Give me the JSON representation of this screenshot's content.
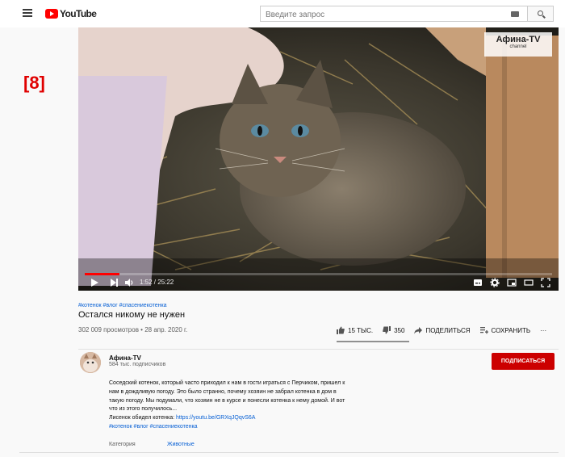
{
  "header": {
    "logo_text": "YouTube",
    "search_placeholder": "Введите запрос"
  },
  "page_tag": "[8]",
  "player": {
    "watermark_name": "Афина-TV",
    "watermark_sub": "channel",
    "time": "1:52 / 25:22",
    "progress_fraction": 0.0738
  },
  "video": {
    "hashtags": "#котенок #влог #спасениекотенка",
    "title": "Остался никому не нужен",
    "views_date": "302 009 просмотров • 28 апр. 2020 г.",
    "likes": "15 ТЫС.",
    "dislikes": "350",
    "share_label": "ПОДЕЛИТЬСЯ",
    "save_label": "СОХРАНИТЬ",
    "more_label": "···"
  },
  "channel": {
    "name": "Афина-TV",
    "subscribers": "584 тыс. подписчиков",
    "subscribe_label": "ПОДПИСАТЬСЯ"
  },
  "description": {
    "line1": "Соседский котенок, который часто приходил к нам в гости играться с Перчиком, пришел к",
    "line2": "нам в дождливую погоду. Это было странно, почему хозяин не забрал котенка в дом в",
    "line3": "такую погоду. Мы подумали, что хозяин не в курсе и понесли котенка к нему домой. И вот",
    "line4": "что из этого получилось...",
    "link_prefix": "Лисенок обидел котенка: ",
    "link": "https://youtu.be/GRXqJQqvS6A",
    "hashtags": "#котенок #влог #спасениекотенка",
    "category_label": "Категория",
    "category_value": "Животные"
  },
  "colors": {
    "brand_red": "#ff0000",
    "subscribe_red": "#cc0000",
    "link_blue": "#065fd4"
  }
}
